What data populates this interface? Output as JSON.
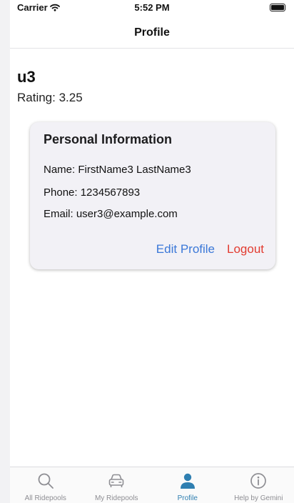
{
  "status_bar": {
    "carrier": "Carrier",
    "time": "5:52 PM"
  },
  "nav": {
    "title": "Profile"
  },
  "profile": {
    "username": "u3",
    "rating": "Rating: 3.25"
  },
  "personal_info": {
    "title": "Personal Information",
    "name": "Name: FirstName3 LastName3",
    "phone": "Phone: 1234567893",
    "email": "Email: user3@example.com",
    "edit_label": "Edit Profile",
    "logout_label": "Logout"
  },
  "tabs": [
    {
      "label": "All Ridepools",
      "icon": "search-icon",
      "active": false
    },
    {
      "label": "My Ridepools",
      "icon": "car-icon",
      "active": false
    },
    {
      "label": "Profile",
      "icon": "person-icon",
      "active": true
    },
    {
      "label": "Help by Gemini",
      "icon": "info-icon",
      "active": false
    }
  ],
  "colors": {
    "accent_blue": "#3b78d8",
    "logout_red": "#e23b30",
    "tab_active": "#2f7fb1",
    "tab_inactive": "#8e8e93",
    "card_bg": "#f2f1f6"
  }
}
